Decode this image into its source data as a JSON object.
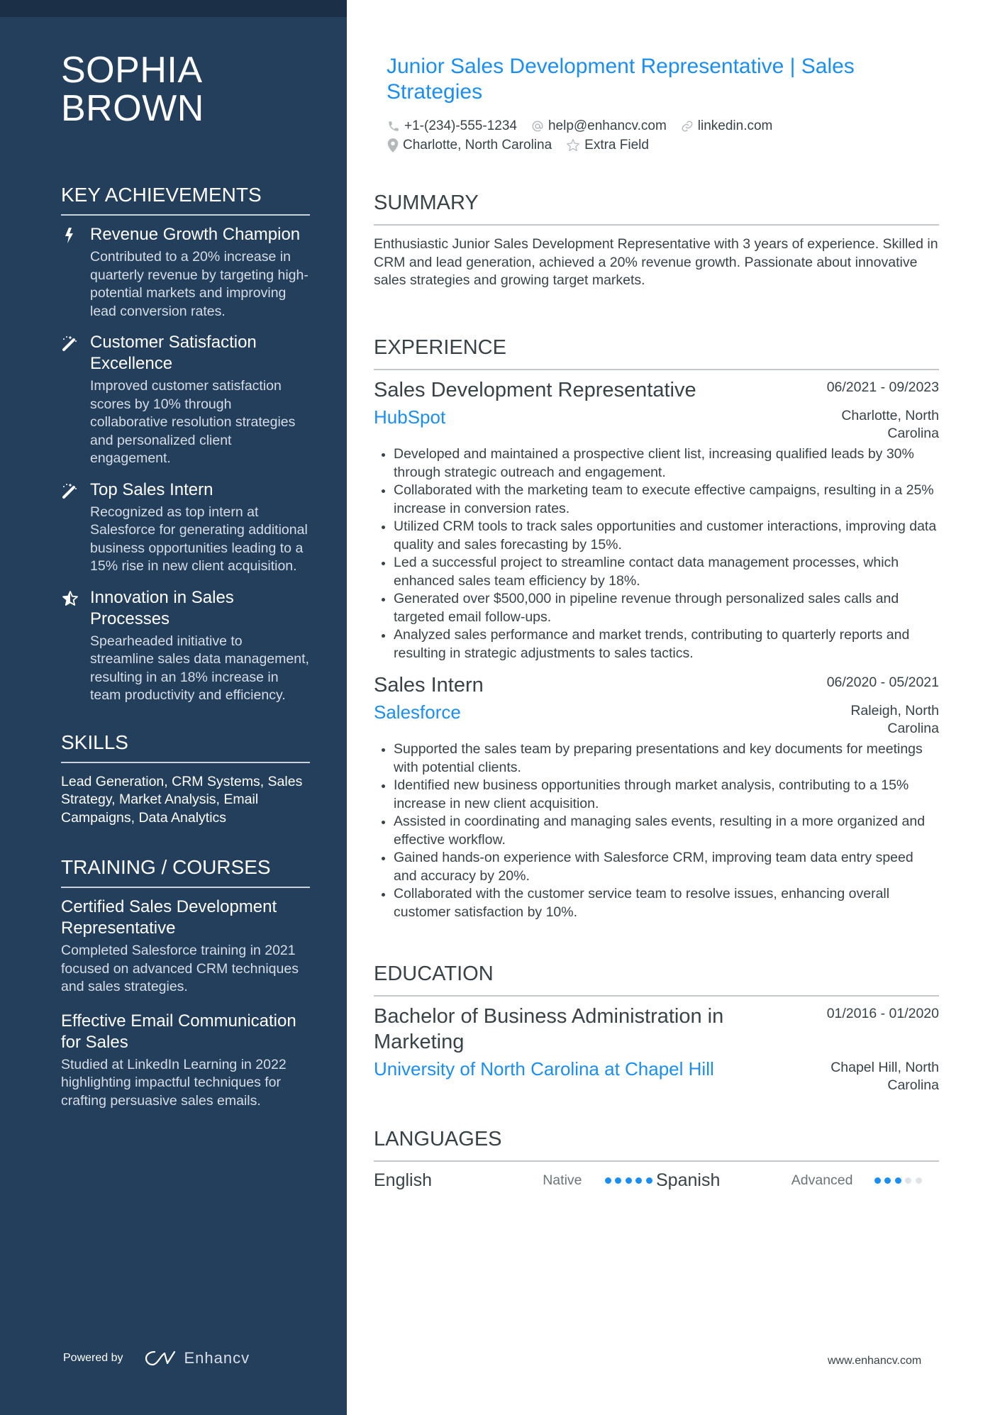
{
  "sidebar": {
    "name_line1": "SOPHIA",
    "name_line2": "BROWN",
    "achievements": {
      "heading": "KEY ACHIEVEMENTS",
      "items": [
        {
          "icon": "lightning-bolt-icon",
          "title": "Revenue Growth Champion",
          "description": "Contributed to a 20% increase in quarterly revenue by targeting high-potential markets and improving lead conversion rates."
        },
        {
          "icon": "magic-wand-icon",
          "title": "Customer Satisfaction Excellence",
          "description": "Improved customer satisfaction scores by 10% through collaborative resolution strategies and personalized client engagement."
        },
        {
          "icon": "magic-wand-icon",
          "title": "Top Sales Intern",
          "description": "Recognized as top intern at Salesforce for generating additional business opportunities leading to a 15% rise in new client acquisition."
        },
        {
          "icon": "star-half-icon",
          "title": "Innovation in Sales Processes",
          "description": "Spearheaded initiative to streamline sales data management, resulting in an 18% increase in team productivity and efficiency."
        }
      ]
    },
    "skills": {
      "heading": "SKILLS",
      "text": "Lead Generation, CRM Systems, Sales Strategy, Market Analysis, Email Campaigns, Data Analytics"
    },
    "training": {
      "heading": "TRAINING / COURSES",
      "items": [
        {
          "title": "Certified Sales Development Representative",
          "description": "Completed Salesforce training in 2021 focused on advanced CRM techniques and sales strategies."
        },
        {
          "title": "Effective Email Communication for Sales",
          "description": "Studied at LinkedIn Learning in 2022 highlighting impactful techniques for crafting persuasive sales emails."
        }
      ]
    },
    "powered_by": "Powered by",
    "brand": "Enhancv"
  },
  "header": {
    "title": "Junior Sales Development Representative | Sales Strategies",
    "phone": "+1-(234)-555-1234",
    "email": "help@enhancv.com",
    "link": "linkedin.com",
    "location": "Charlotte, North Carolina",
    "extra": "Extra Field"
  },
  "summary": {
    "heading": "SUMMARY",
    "text": "Enthusiastic Junior Sales Development Representative with 3 years of experience. Skilled in CRM and lead generation, achieved a 20% revenue growth. Passionate about innovative sales strategies and growing target markets."
  },
  "experience": {
    "heading": "EXPERIENCE",
    "jobs": [
      {
        "title": "Sales Development Representative",
        "dates": "06/2021 - 09/2023",
        "company": "HubSpot",
        "location": "Charlotte, North Carolina",
        "bullets": [
          "Developed and maintained a prospective client list, increasing qualified leads by 30% through strategic outreach and engagement.",
          "Collaborated with the marketing team to execute effective campaigns, resulting in a 25% increase in conversion rates.",
          "Utilized CRM tools to track sales opportunities and customer interactions, improving data quality and sales forecasting by 15%.",
          "Led a successful project to streamline contact data management processes, which enhanced sales team efficiency by 18%.",
          "Generated over $500,000 in pipeline revenue through personalized sales calls and targeted email follow-ups.",
          "Analyzed sales performance and market trends, contributing to quarterly reports and resulting in strategic adjustments to sales tactics."
        ]
      },
      {
        "title": "Sales Intern",
        "dates": "06/2020 - 05/2021",
        "company": "Salesforce",
        "location": "Raleigh, North Carolina",
        "bullets": [
          "Supported the sales team by preparing presentations and key documents for meetings with potential clients.",
          "Identified new business opportunities through market analysis, contributing to a 15% increase in new client acquisition.",
          "Assisted in coordinating and managing sales events, resulting in a more organized and effective workflow.",
          "Gained hands-on experience with Salesforce CRM, improving team data entry speed and accuracy by 20%.",
          "Collaborated with the customer service team to resolve issues, enhancing overall customer satisfaction by 10%."
        ]
      }
    ]
  },
  "education": {
    "heading": "EDUCATION",
    "degree": "Bachelor of Business Administration in Marketing",
    "dates": "01/2016 - 01/2020",
    "school": "University of North Carolina at Chapel Hill",
    "location": "Chapel Hill, North Carolina"
  },
  "languages": {
    "heading": "LANGUAGES",
    "items": [
      {
        "name": "English",
        "level": "Native",
        "rating": 5,
        "max": 5
      },
      {
        "name": "Spanish",
        "level": "Advanced",
        "rating": 3,
        "max": 5
      }
    ]
  },
  "footer": {
    "url": "www.enhancv.com"
  },
  "colors": {
    "sidebar_bg": "#233f5c",
    "accent": "#1a8ef2",
    "text": "#384347"
  }
}
